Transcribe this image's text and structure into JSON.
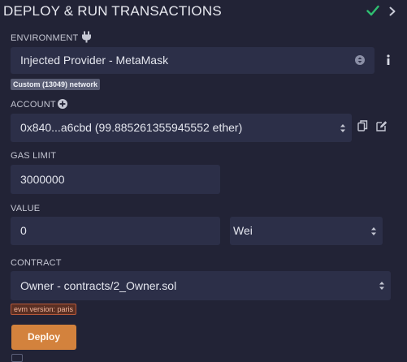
{
  "header": {
    "title": "DEPLOY & RUN TRANSACTIONS",
    "check_icon": "check-icon",
    "collapse_icon": "chevron-right-icon",
    "check_color": "#2fbf71"
  },
  "environment": {
    "label": "ENVIRONMENT",
    "icon": "plug-icon",
    "value": "Injected Provider - MetaMask",
    "info_icon": "info-icon",
    "network_badge": "Custom (13049) network"
  },
  "account": {
    "label": "ACCOUNT",
    "add_icon": "plus-circle-icon",
    "value": "0x840...a6cbd (99.885261355945552 ether)",
    "copy_icon": "copy-icon",
    "edit_icon": "edit-icon"
  },
  "gas_limit": {
    "label": "GAS LIMIT",
    "value": "3000000"
  },
  "value": {
    "label": "VALUE",
    "amount": "0",
    "unit": "Wei"
  },
  "contract": {
    "label": "CONTRACT",
    "value": "Owner - contracts/2_Owner.sol",
    "evm_badge": "evm version: paris"
  },
  "deploy": {
    "label": "Deploy",
    "color": "#d3823d"
  }
}
